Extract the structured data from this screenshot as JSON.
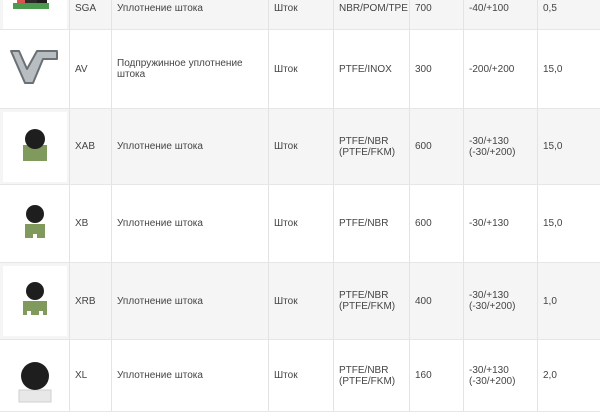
{
  "rows": [
    {
      "code": "SGA",
      "desc": "Уплотнение штока",
      "type": "Шток",
      "material": "NBR/POM/TPE",
      "pressure": "700",
      "temp": "-40/+100",
      "speed": "0,5",
      "icon": "sga-profile-icon"
    },
    {
      "code": "AV",
      "desc": "Подпружинное уплотнение\nштока",
      "type": "Шток",
      "material": "PTFE/INOX",
      "pressure": "300",
      "temp": "-200/+200",
      "speed": "15,0",
      "icon": "av-profile-icon"
    },
    {
      "code": "XAB",
      "desc": "Уплотнение штока",
      "type": "Шток",
      "material": "PTFE/NBR\n(PTFE/FKM)",
      "pressure": "600",
      "temp": "-30/+130\n(-30/+200)",
      "speed": "15,0",
      "icon": "xab-profile-icon"
    },
    {
      "code": "XB",
      "desc": "Уплотнение штока",
      "type": "Шток",
      "material": "PTFE/NBR",
      "pressure": "600",
      "temp": "-30/+130",
      "speed": "15,0",
      "icon": "xb-profile-icon"
    },
    {
      "code": "XRB",
      "desc": "Уплотнение штока",
      "type": "Шток",
      "material": "PTFE/NBR\n(PTFE/FKM)",
      "pressure": "400",
      "temp": "-30/+130\n(-30/+200)",
      "speed": "1,0",
      "icon": "xrb-profile-icon"
    },
    {
      "code": "XL",
      "desc": "Уплотнение штока",
      "type": "Шток",
      "material": "PTFE/NBR\n(PTFE/FKM)",
      "pressure": "160",
      "temp": "-30/+130\n(-30/+200)",
      "speed": "2,0",
      "icon": "xl-profile-icon"
    }
  ],
  "colors": {
    "stripe": "#f5f5f5",
    "border": "#e3e3e3",
    "text": "#444444",
    "seal_green": "#7f9a5c",
    "seal_black": "#1e1e1e",
    "ring_grey": "#b8bdc2"
  }
}
